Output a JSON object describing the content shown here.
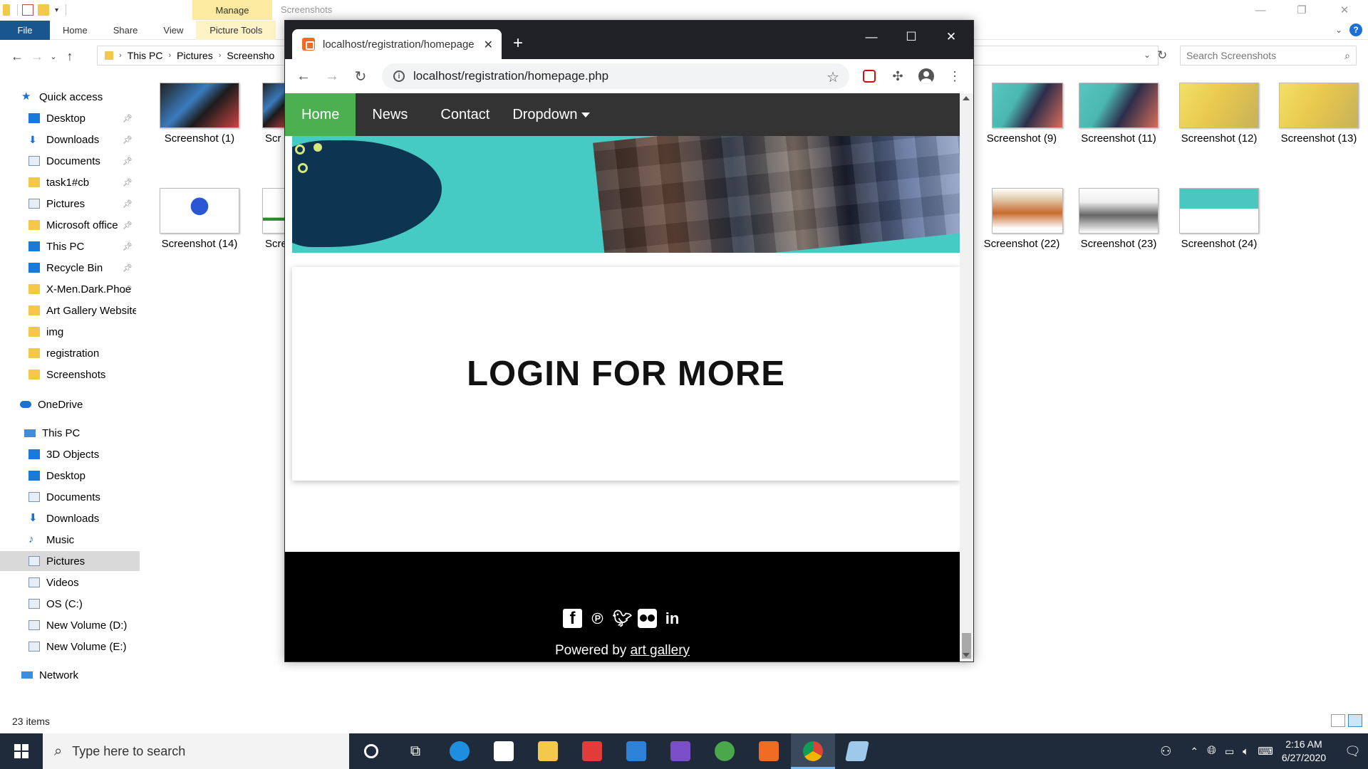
{
  "explorer": {
    "title": "Screenshots",
    "manage_label": "Manage",
    "ribbon_tabs": [
      "File",
      "Home",
      "Share",
      "View",
      "Picture Tools"
    ],
    "breadcrumb": [
      "This PC",
      "Pictures",
      "Screensho"
    ],
    "search_placeholder": "Search Screenshots",
    "nav": {
      "quick_access": "Quick access",
      "quick_items": [
        "Desktop",
        "Downloads",
        "Documents",
        "task1#cb",
        "Pictures",
        "Microsoft office",
        "This PC",
        "Recycle Bin",
        "X-Men.Dark.Phoe",
        "Art Gallery Website",
        "img",
        "registration",
        "Screenshots"
      ],
      "onedrive": "OneDrive",
      "this_pc": "This PC",
      "pc_items": [
        "3D Objects",
        "Desktop",
        "Documents",
        "Downloads",
        "Music",
        "Pictures",
        "Videos",
        "OS (C:)",
        "New Volume (D:)",
        "New Volume (E:)"
      ],
      "network": "Network"
    },
    "files_row1": [
      "Screenshot (1)",
      "Scr",
      "Screenshot (9)",
      "Screenshot (11)",
      "Screenshot (12)",
      "Screenshot (13)"
    ],
    "files_row2": [
      "Screenshot (14)",
      "Scre",
      "Screenshot (22)",
      "Screenshot (23)",
      "Screenshot (24)"
    ],
    "status": "23 items"
  },
  "chrome": {
    "tab_title": "localhost/registration/homepage",
    "url": "localhost/registration/homepage.php",
    "site": {
      "nav": [
        "Home",
        "News",
        "Contact",
        "Dropdown"
      ],
      "card_title": "LOGIN FOR MORE",
      "powered_prefix": "Powered by ",
      "powered_link": "art gallery"
    }
  },
  "taskbar": {
    "search_placeholder": "Type here to search",
    "time": "2:16 AM",
    "date": "6/27/2020"
  },
  "colors": {
    "nav_bg": "#333333",
    "nav_active": "#4caf50",
    "hero_teal": "#46cbc4",
    "footer_bg": "#000000",
    "taskbar_bg": "#1f2b3a"
  }
}
